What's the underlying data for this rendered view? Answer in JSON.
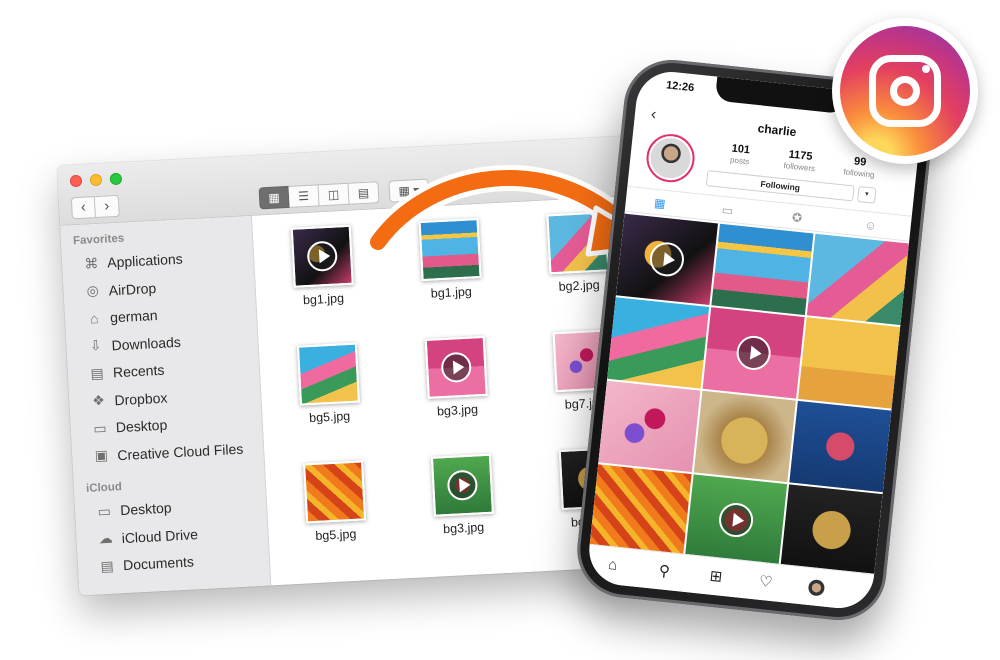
{
  "finder": {
    "sidebar": {
      "favorites_heading": "Favorites",
      "favorites": [
        {
          "label": "Applications",
          "icon": "applications-icon"
        },
        {
          "label": "AirDrop",
          "icon": "airdrop-icon"
        },
        {
          "label": "german",
          "icon": "home-icon"
        },
        {
          "label": "Downloads",
          "icon": "downloads-icon"
        },
        {
          "label": "Recents",
          "icon": "recents-icon"
        },
        {
          "label": "Dropbox",
          "icon": "dropbox-icon"
        },
        {
          "label": "Desktop",
          "icon": "desktop-icon"
        },
        {
          "label": "Creative Cloud Files",
          "icon": "folder-icon"
        }
      ],
      "icloud_heading": "iCloud",
      "icloud": [
        {
          "label": "Desktop",
          "icon": "desktop-icon"
        },
        {
          "label": "iCloud Drive",
          "icon": "cloud-icon"
        },
        {
          "label": "Documents",
          "icon": "documents-icon"
        }
      ]
    },
    "files": [
      {
        "name": "bg1.jpg",
        "video": true
      },
      {
        "name": "bg1.jpg",
        "video": false
      },
      {
        "name": "bg2.jpg",
        "video": false
      },
      {
        "name": "bg5.jpg",
        "video": false
      },
      {
        "name": "bg3.jpg",
        "video": true
      },
      {
        "name": "bg7.jpg",
        "video": false
      },
      {
        "name": "bg5.jpg",
        "video": false
      },
      {
        "name": "bg3.jpg",
        "video": true
      },
      {
        "name": "bg7.jpg",
        "video": false
      }
    ]
  },
  "phone": {
    "time": "12:26",
    "username": "charlie",
    "stats": [
      {
        "value": "101",
        "label": "posts"
      },
      {
        "value": "1175",
        "label": "followers"
      },
      {
        "value": "99",
        "label": "following"
      }
    ],
    "follow_button": "Following",
    "grid_videos": [
      true,
      false,
      false,
      false,
      true,
      false,
      false,
      false,
      false,
      false,
      true,
      false
    ]
  },
  "colors": {
    "accent_orange": "#f36c12",
    "instagram_pink": "#e1306c",
    "link_blue": "#3897f0"
  }
}
